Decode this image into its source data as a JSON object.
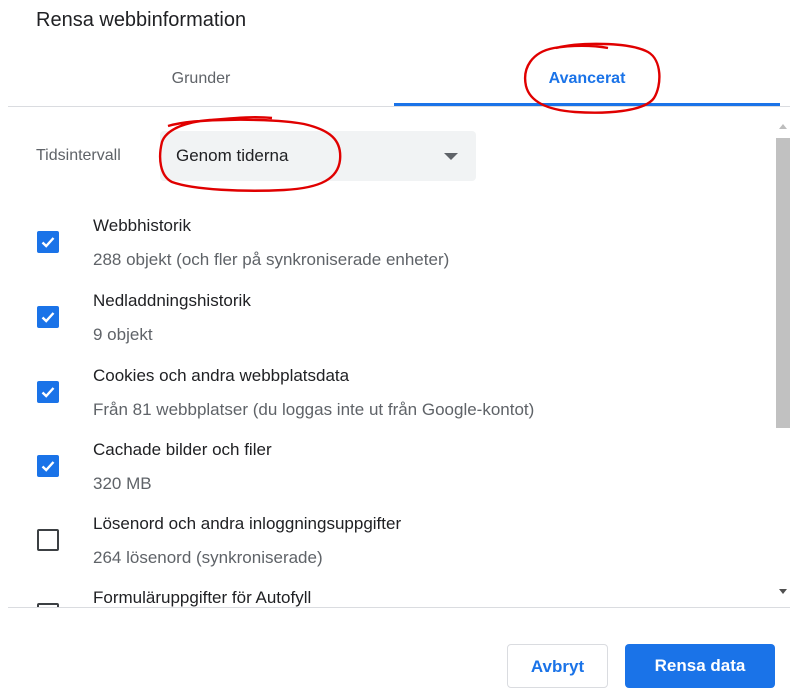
{
  "dialog": {
    "title": "Rensa webbinformation"
  },
  "tabs": [
    {
      "label": "Grunder",
      "selected": false
    },
    {
      "label": "Avancerat",
      "selected": true
    }
  ],
  "time_range": {
    "label": "Tidsintervall",
    "value": "Genom tiderna"
  },
  "items": [
    {
      "title": "Webbhistorik",
      "description": "288 objekt (och fler på synkroniserade enheter)",
      "checked": true
    },
    {
      "title": "Nedladdningshistorik",
      "description": "9 objekt",
      "checked": true
    },
    {
      "title": "Cookies och andra webbplatsdata",
      "description": "Från 81 webbplatser (du loggas inte ut från Google-kontot)",
      "checked": true
    },
    {
      "title": "Cachade bilder och filer",
      "description": "320 MB",
      "checked": true
    },
    {
      "title": "Lösenord och andra inloggningsuppgifter",
      "description": "264 lösenord (synkroniserade)",
      "checked": false
    },
    {
      "title": "Formuläruppgifter för Autofyll",
      "description": "",
      "checked": false
    }
  ],
  "footer": {
    "cancel_label": "Avbryt",
    "clear_label": "Rensa data"
  },
  "colors": {
    "accent": "#1a73e8",
    "annotation": "#e00000"
  }
}
